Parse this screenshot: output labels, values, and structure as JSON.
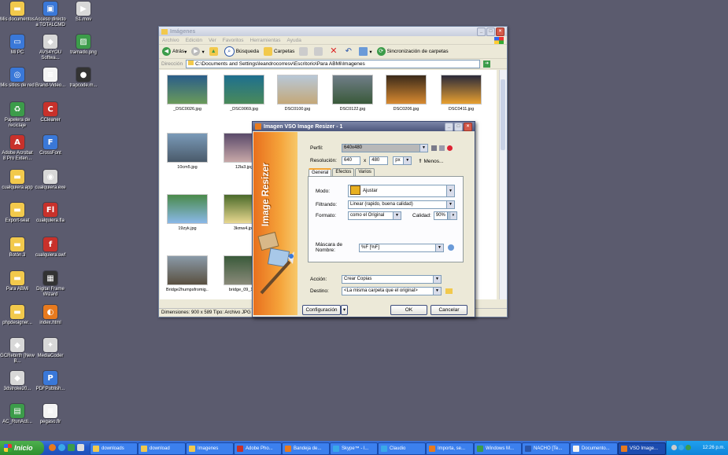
{
  "desktop": {
    "icons": [
      {
        "label": "Mis documentos",
        "icon": "folder-icon"
      },
      {
        "label": "Acceso directo a TOTALCMD",
        "icon": "floppy-icon"
      },
      {
        "label": "S1.mov",
        "icon": "video-icon"
      },
      {
        "label": "Mi PC",
        "icon": "computer-icon"
      },
      {
        "label": "AVS4YOU Softwa...",
        "icon": "app-icon"
      },
      {
        "label": "tramado.png",
        "icon": "image-icon"
      },
      {
        "label": "Mis sitios de red",
        "icon": "network-icon"
      },
      {
        "label": "Brand-Video...",
        "icon": "doc-icon"
      },
      {
        "label": "trapcode.m...",
        "icon": "film-icon"
      },
      {
        "label": "Papelera de reciclaje",
        "icon": "recycle-icon"
      },
      {
        "label": "CCleaner",
        "icon": "ccleaner-icon"
      },
      {
        "label": "Adobe Acrobat 8 Pro Exten...",
        "icon": "acrobat-icon"
      },
      {
        "label": "CrossFont",
        "icon": "crossfont-icon"
      },
      {
        "label": "cualquiera.app",
        "icon": "folder-icon"
      },
      {
        "label": "cualquiera.exe",
        "icon": "exe-icon"
      },
      {
        "label": "Export-seat",
        "icon": "folder-icon"
      },
      {
        "label": "cualquiera.fla",
        "icon": "flash-icon"
      },
      {
        "label": "Botón.3",
        "icon": "folder-icon"
      },
      {
        "label": "cualquiera.swf",
        "icon": "swf-icon"
      },
      {
        "label": "Para ABMi",
        "icon": "folder-icon"
      },
      {
        "label": "Digital Frame Wizard",
        "icon": "frame-icon"
      },
      {
        "label": "phpdesigner...",
        "icon": "folder-icon"
      },
      {
        "label": "index.html",
        "icon": "firefox-icon"
      },
      {
        "label": "GCRebirth [New B...",
        "icon": "app-icon"
      },
      {
        "label": "MediaCoder",
        "icon": "mediacoder-icon"
      },
      {
        "label": "3dstroke20...",
        "icon": "app-icon"
      },
      {
        "label": "PDFPublish...",
        "icon": "pdf-icon"
      },
      {
        "label": "AC_RunActi...",
        "icon": "script-icon"
      },
      {
        "label": "pegaso.flr",
        "icon": "doc-icon"
      }
    ]
  },
  "explorer": {
    "title": "Imágenes",
    "menu": [
      "Archivo",
      "Edición",
      "Ver",
      "Favoritos",
      "Herramientas",
      "Ayuda"
    ],
    "toolbar": {
      "back": "Atrás",
      "search": "Búsqueda",
      "folders": "Carpetas",
      "sync": "Sincronización de carpetas"
    },
    "address_label": "Dirección",
    "address": "C:\\Documents and Settings\\leandrocorresv\\Escritorio\\Para ABMi\\Imagenes",
    "files": [
      {
        "name": "_DSC0026.jpg",
        "c1": "#2a5d8a",
        "c2": "#6a9a5a"
      },
      {
        "name": "_DSC0069.jpg",
        "c1": "#1e6f8f",
        "c2": "#4a8a5a"
      },
      {
        "name": "DSC0100.jpg",
        "c1": "#b8c8d8",
        "c2": "#c4a878"
      },
      {
        "name": "DSC0122.jpg",
        "c1": "#707e88",
        "c2": "#3a5a3a"
      },
      {
        "name": "DSC0206.jpg",
        "c1": "#3a2a1a",
        "c2": "#d88a30"
      },
      {
        "name": "DSC0411.jpg",
        "c1": "#2a2a3a",
        "c2": "#e8a030"
      },
      {
        "name": "10cm5.jpg",
        "c1": "#7a9ab8",
        "c2": "#4a5a6a"
      },
      {
        "name": "12la3.jpg",
        "c1": "#5a4a6a",
        "c2": "#c8a8a8"
      },
      {
        "name": "19zyk.jpg",
        "c1": "#4a8a4a",
        "c2": "#8ab8e8"
      },
      {
        "name": "3kmw4.jpg",
        "c1": "#4a6a2a",
        "c2": "#e8d890"
      },
      {
        "name": "Bridge2humpsfromig...",
        "c1": "#8a9aa8",
        "c2": "#5a5040"
      },
      {
        "name": "bridge_09_12...",
        "c1": "#3a5a3a",
        "c2": "#8a8a7a"
      }
    ],
    "status": "Dimensiones: 900 x 589 Tipo: Archivo JPG Ta..."
  },
  "dialog": {
    "title": "Imagen VSO Image Resizer - 1",
    "banner": "Image Resizer",
    "perfil_label": "Perfil:",
    "perfil_value": "640x480",
    "resolucion_label": "Resolución:",
    "res_w": "640",
    "res_x": "x",
    "res_h": "480",
    "res_unit": "px",
    "menos": "Menos...",
    "tabs": [
      "General",
      "Efectos",
      "Varios"
    ],
    "modo_label": "Modo:",
    "modo_value": "Ajustar",
    "filtrando_label": "Filtrando:",
    "filtrando_value": "Linear (rapido, buena calidad)",
    "formato_label": "Formato:",
    "formato_value": "como el Original",
    "calidad_label": "Calidad:",
    "calidad_value": "90%",
    "mascara_label": "Máscara de Nombre:",
    "mascara_value": "%F [%F]",
    "accion_label": "Acción:",
    "accion_value": "Crear Copias",
    "destino_label": "Destino:",
    "destino_value": "<La misma carpeta que el original>",
    "config_btn": "Configuración",
    "ok_btn": "OK",
    "cancel_btn": "Cancelar"
  },
  "taskbar": {
    "start": "Inicio",
    "tasks": [
      {
        "label": "downloads",
        "color": "#f2c94c"
      },
      {
        "label": "download",
        "color": "#f2c94c"
      },
      {
        "label": "Imagenes",
        "color": "#f2c94c"
      },
      {
        "label": "Adobe Pho...",
        "color": "#c8312b"
      },
      {
        "label": "Bandeja de...",
        "color": "#e87a1e"
      },
      {
        "label": "Skype™ - l...",
        "color": "#3aa8e8"
      },
      {
        "label": "Claudio",
        "color": "#3aa8e8"
      },
      {
        "label": "Importa, se...",
        "color": "#e87a1e"
      },
      {
        "label": "Windows M...",
        "color": "#3c9c4a"
      },
      {
        "label": "NACHO [Te...",
        "color": "#2a55aa"
      },
      {
        "label": "Documento...",
        "color": "#f4f4f4"
      },
      {
        "label": "VSO Image...",
        "color": "#e87a1e"
      }
    ],
    "clock": "12:26 p.m."
  }
}
